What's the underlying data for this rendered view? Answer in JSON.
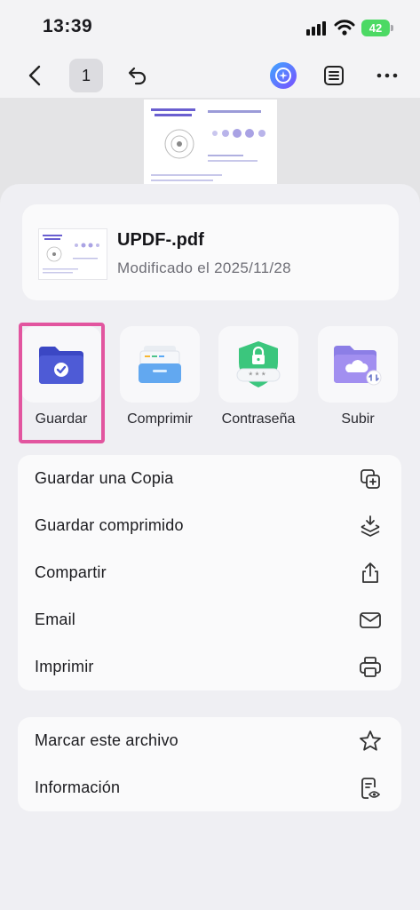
{
  "status_bar": {
    "time": "13:39",
    "battery": "42"
  },
  "toolbar": {
    "page_number": "1"
  },
  "file": {
    "name": "UPDF-.pdf",
    "modified": "Modificado el 2025/11/28"
  },
  "actions": [
    {
      "label": "Guardar",
      "icon": "folder-check-icon"
    },
    {
      "label": "Comprimir",
      "icon": "archive-tray-icon"
    },
    {
      "label": "Contraseña",
      "icon": "shield-lock-icon"
    },
    {
      "label": "Subir",
      "icon": "folder-cloud-icon"
    }
  ],
  "menu1": [
    {
      "label": "Guardar una Copia",
      "icon": "copy-plus-icon"
    },
    {
      "label": "Guardar comprimido",
      "icon": "compress-layers-icon"
    },
    {
      "label": "Compartir",
      "icon": "share-icon"
    },
    {
      "label": "Email",
      "icon": "mail-icon"
    },
    {
      "label": "Imprimir",
      "icon": "printer-icon"
    }
  ],
  "menu2": [
    {
      "label": "Marcar este archivo",
      "icon": "star-icon"
    },
    {
      "label": "Información",
      "icon": "document-eye-icon"
    }
  ],
  "colors": {
    "highlight": "#e2559f",
    "accent": "#4e5bd6",
    "shield": "#3bc67d"
  }
}
